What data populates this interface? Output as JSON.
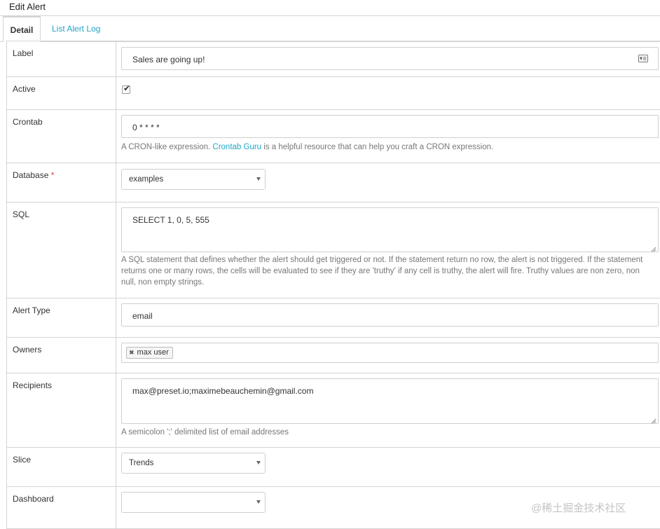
{
  "window": {
    "title": "Edit Alert"
  },
  "tabs": [
    {
      "label": "Detail"
    },
    {
      "label": "List Alert Log"
    }
  ],
  "fields": {
    "label": {
      "label": "Label",
      "value": "Sales are going up!",
      "icon": "id-card-icon"
    },
    "active": {
      "label": "Active",
      "checked": true,
      "check_glyph": "✔"
    },
    "crontab": {
      "label": "Crontab",
      "value": "0 * * * *",
      "help_prefix": "A CRON-like expression.",
      "help_link": "Crontab Guru",
      "help_suffix": "is a helpful resource that can help you craft a CRON expression."
    },
    "database": {
      "label": "Database",
      "required_mark": "*",
      "value": "examples"
    },
    "sql": {
      "label": "SQL",
      "value": "SELECT 1, 0, 5, 555",
      "help": "A SQL statement that defines whether the alert should get triggered or not. If the statement return no row, the alert is not triggered. If the statement returns one or many rows, the cells will be evaluated to see if they are 'truthy' if any cell is truthy, the alert will fire. Truthy values are non zero, non null, non empty strings."
    },
    "alert_type": {
      "label": "Alert Type",
      "value": "email"
    },
    "owners": {
      "label": "Owners",
      "tags": [
        {
          "label": "max user",
          "remove_glyph": "✖"
        }
      ]
    },
    "recipients": {
      "label": "Recipients",
      "value": "max@preset.io;maximebeauchemin@gmail.com",
      "help": "A semicolon ';' delimited list of email addresses"
    },
    "slice": {
      "label": "Slice",
      "value": "Trends"
    },
    "dashboard": {
      "label": "Dashboard",
      "value": ""
    }
  },
  "watermark": "@稀土掘金技术社区",
  "colors": {
    "link": "#20a7c9",
    "required": "#e04141",
    "border": "#d4d4d4",
    "help_text": "#777777"
  }
}
